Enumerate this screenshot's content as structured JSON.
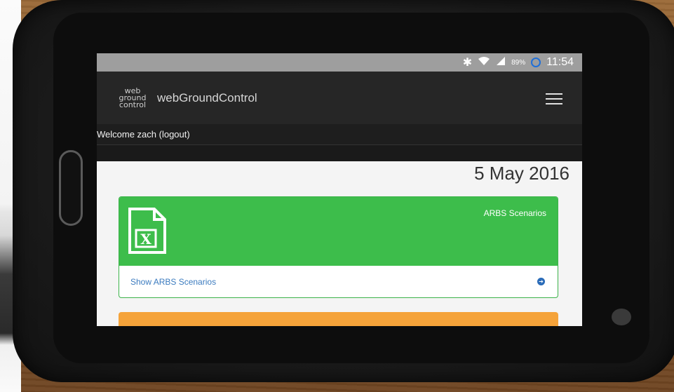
{
  "status_bar": {
    "battery_percent": "89%",
    "time": "11:54",
    "icons": [
      "bluetooth-icon",
      "wifi-icon",
      "signal-icon",
      "battery-icon"
    ]
  },
  "navbar": {
    "logo_lines": [
      "web",
      "ground",
      "control"
    ],
    "brand": "webGroundControl",
    "menu_icon": "hamburger-menu-icon"
  },
  "welcome": {
    "text": "Welcome zach (logout)"
  },
  "content": {
    "date": "5 May 2016",
    "panels": [
      {
        "title": "ARBS Scenarios",
        "icon": "excel-file-icon",
        "icon_letter": "X",
        "footer_link": "Show ARBS Scenarios",
        "color": "#3dbd4b"
      },
      {
        "color": "#f5a33a"
      }
    ]
  },
  "colors": {
    "navbar": "#262626",
    "status_bar": "#9e9e9e",
    "link": "#3b7bbf"
  }
}
